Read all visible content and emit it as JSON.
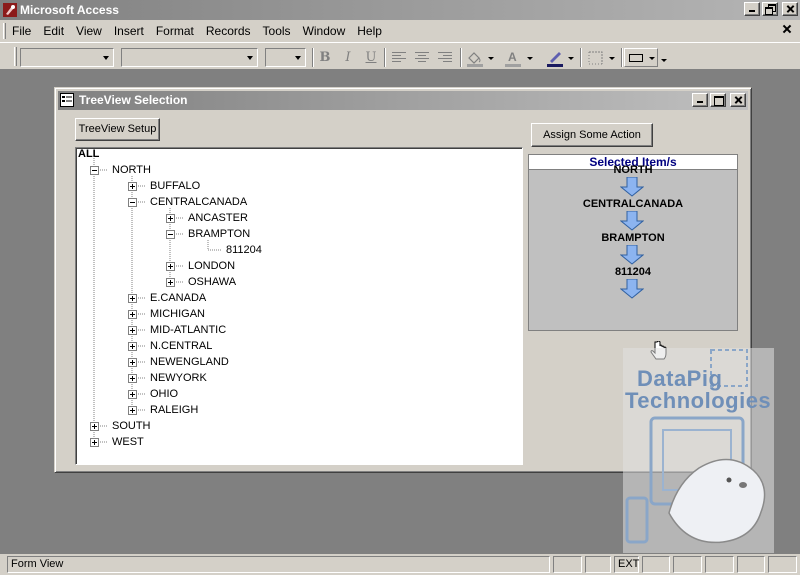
{
  "app": {
    "title": "Microsoft Access"
  },
  "menu": [
    "File",
    "Edit",
    "View",
    "Insert",
    "Format",
    "Records",
    "Tools",
    "Window",
    "Help"
  ],
  "form": {
    "title": "TreeView Selection",
    "setup_button": "TreeView Setup",
    "action_button": "Assign Some Action"
  },
  "tree": {
    "root": "ALL",
    "nodes": [
      {
        "label": "NORTH",
        "level": 1,
        "expander": "minus"
      },
      {
        "label": "BUFFALO",
        "level": 2,
        "expander": "plus"
      },
      {
        "label": "CENTRALCANADA",
        "level": 2,
        "expander": "minus"
      },
      {
        "label": "ANCASTER",
        "level": 3,
        "expander": "plus"
      },
      {
        "label": "BRAMPTON",
        "level": 3,
        "expander": "minus"
      },
      {
        "label": "811204",
        "level": 4,
        "expander": "none"
      },
      {
        "label": "LONDON",
        "level": 3,
        "expander": "plus"
      },
      {
        "label": "OSHAWA",
        "level": 3,
        "expander": "plus"
      },
      {
        "label": "E.CANADA",
        "level": 2,
        "expander": "plus"
      },
      {
        "label": "MICHIGAN",
        "level": 2,
        "expander": "plus"
      },
      {
        "label": "MID-ATLANTIC",
        "level": 2,
        "expander": "plus"
      },
      {
        "label": "N.CENTRAL",
        "level": 2,
        "expander": "plus"
      },
      {
        "label": "NEWENGLAND",
        "level": 2,
        "expander": "plus"
      },
      {
        "label": "NEWYORK",
        "level": 2,
        "expander": "plus"
      },
      {
        "label": "OHIO",
        "level": 2,
        "expander": "plus"
      },
      {
        "label": "RALEIGH",
        "level": 2,
        "expander": "plus"
      },
      {
        "label": "SOUTH",
        "level": 1,
        "expander": "plus"
      },
      {
        "label": "WEST",
        "level": 1,
        "expander": "plus"
      }
    ]
  },
  "selected": {
    "header": "Selected Item/s",
    "items": [
      "NORTH",
      "CENTRALCANADA",
      "BRAMPTON",
      "811204"
    ]
  },
  "watermark": {
    "line1": "DataPig",
    "line2": "Technologies"
  },
  "status": {
    "mode": "Form View",
    "ext": "EXT"
  },
  "colors": {
    "title_active": "#808080",
    "mdi_background": "#808080",
    "selected_header_text": "#000080",
    "arrow_fill": "#8cb4f0"
  }
}
